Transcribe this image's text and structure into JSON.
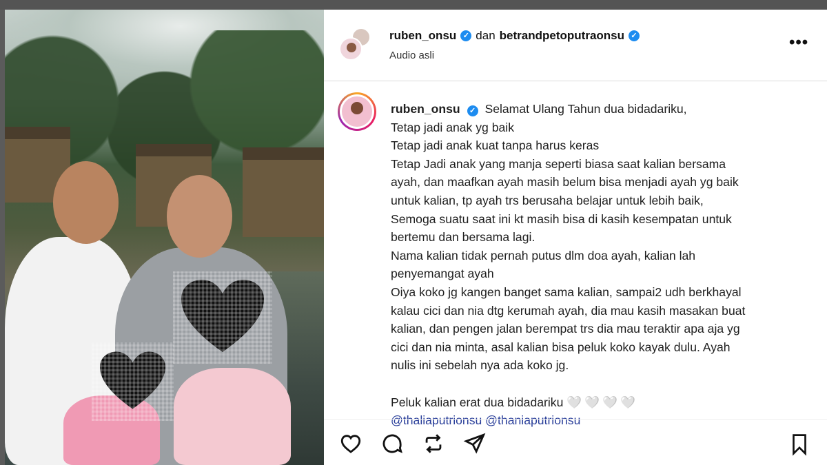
{
  "post": {
    "author": "ruben_onsu",
    "connector": "dan",
    "collaborator": "betrandpetoputraonsu",
    "audio": "Audio asli",
    "more_label": "•••"
  },
  "caption": {
    "username": "ruben_onsu",
    "lines": [
      "Selamat Ulang Tahun dua bidadariku,",
      "Tetap jadi anak yg baik",
      "Tetap jadi anak kuat tanpa harus keras",
      "Tetap Jadi anak yang manja seperti biasa saat kalian bersama",
      "ayah, dan maafkan ayah masih belum bisa menjadi ayah yg baik",
      "untuk kalian, tp ayah trs berusaha belajar untuk lebih baik,",
      "Semoga suatu saat ini kt masih bisa di kasih kesempatan untuk",
      "bertemu dan bersama lagi.",
      "Nama kalian tidak pernah putus dlm doa ayah, kalian lah",
      "penyemangat ayah",
      "Oiya koko jg kangen banget sama kalian, sampai2 udh berkhayal",
      "kalau cici dan nia dtg kerumah ayah, dia mau kasih masakan buat",
      "kalian, dan pengen jalan berempat trs dia mau teraktir apa aja yg",
      "cici dan nia minta, asal kalian bisa peluk koko kayak dulu. Ayah",
      "nulis ini sebelah nya ada koko jg."
    ],
    "closing": "Peluk kalian erat dua bidadariku",
    "hearts": "🤍🤍🤍🤍",
    "mentions": "@thaliaputrionsu @thaniaputrionsu"
  },
  "actions": {
    "like_icon": "heart-icon",
    "comment_icon": "comment-icon",
    "repost_icon": "repost-icon",
    "share_icon": "send-icon",
    "save_icon": "bookmark-icon"
  },
  "colors": {
    "verified": "#1d8cf0",
    "mention": "#2a3f9a",
    "hearts": "#c9b7ee"
  }
}
